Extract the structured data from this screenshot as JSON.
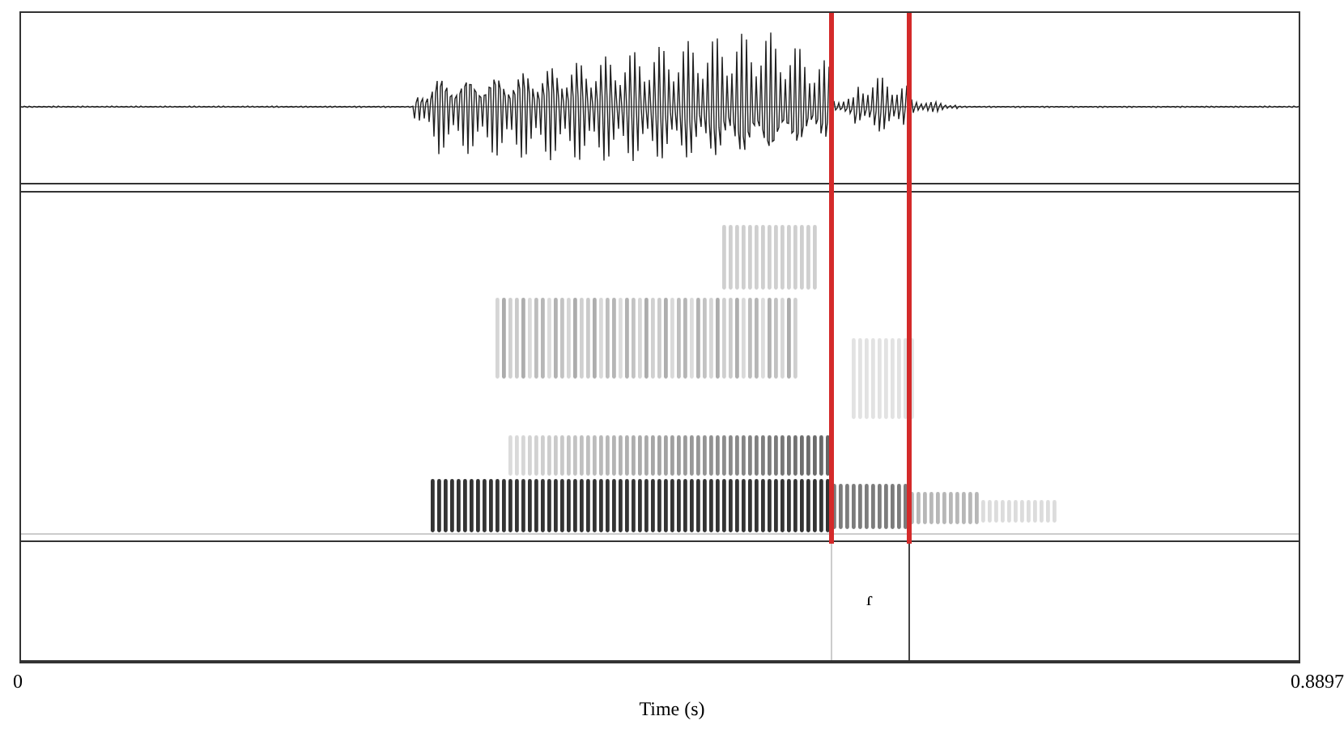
{
  "tier": {
    "interval_label": "ɾ"
  },
  "axis": {
    "start": "0",
    "end": "0.8897",
    "label": "Time (s)"
  }
}
